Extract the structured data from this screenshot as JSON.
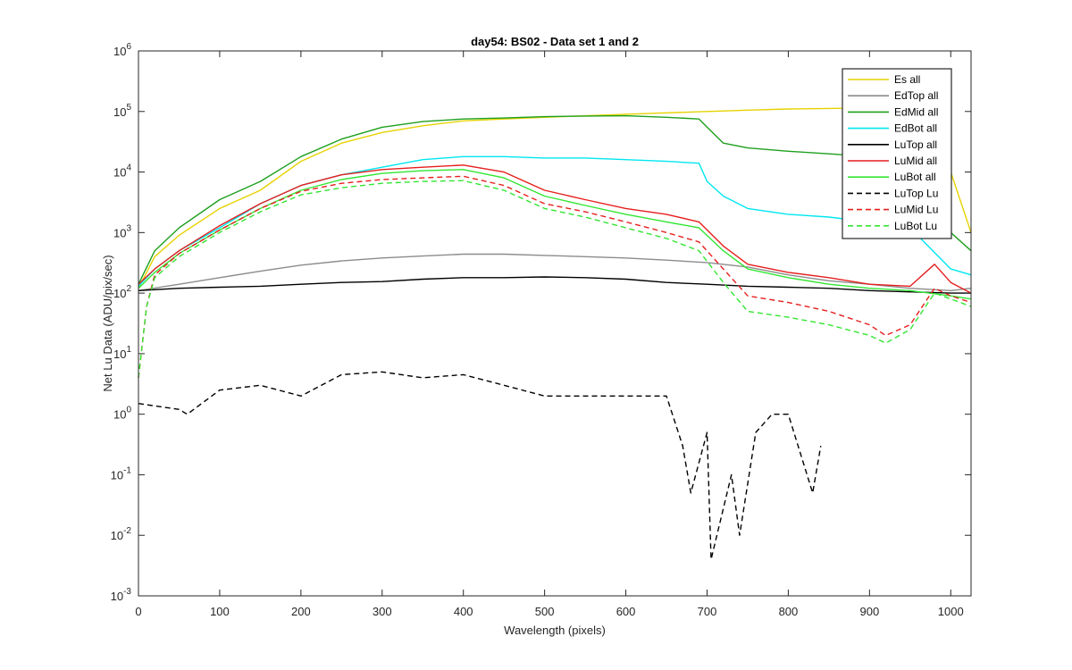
{
  "chart_data": {
    "type": "line",
    "title": "day54: BS02 - Data set 1 and 2",
    "xlabel": "Wavelength (pixels)",
    "ylabel": "Net Lu Data (ADU/pix/sec)",
    "xlim": [
      0,
      1025
    ],
    "ylim": [
      0.001,
      1000000
    ],
    "yscale": "log",
    "grid": false,
    "legend_position": "top-right",
    "x_ticks": [
      0,
      100,
      200,
      300,
      400,
      500,
      600,
      700,
      800,
      900,
      1000
    ],
    "x_tick_labels": [
      "0",
      "100",
      "200",
      "300",
      "400",
      "500",
      "600",
      "700",
      "800",
      "900",
      "1000"
    ],
    "y_ticks": [
      0.001,
      0.01,
      0.1,
      1,
      10,
      100,
      1000,
      10000,
      100000,
      1000000
    ],
    "y_tick_labels": [
      {
        "base": "10",
        "exp": "-3"
      },
      {
        "base": "10",
        "exp": "-2"
      },
      {
        "base": "10",
        "exp": "-1"
      },
      {
        "base": "10",
        "exp": "0"
      },
      {
        "base": "10",
        "exp": "1"
      },
      {
        "base": "10",
        "exp": "2"
      },
      {
        "base": "10",
        "exp": "3"
      },
      {
        "base": "10",
        "exp": "4"
      },
      {
        "base": "10",
        "exp": "5"
      },
      {
        "base": "10",
        "exp": "6"
      }
    ],
    "series": [
      {
        "name": "Es  all",
        "color": "#E6D200",
        "dash": "solid",
        "x": [
          0,
          20,
          50,
          100,
          150,
          200,
          250,
          300,
          350,
          400,
          450,
          500,
          550,
          600,
          650,
          700,
          750,
          800,
          850,
          900,
          950,
          980,
          1000,
          1025
        ],
        "y": [
          120,
          400,
          900,
          2500,
          5000,
          15000,
          30000,
          45000,
          58000,
          70000,
          75000,
          80000,
          85000,
          90000,
          95000,
          100000,
          105000,
          110000,
          112000,
          115000,
          110000,
          50000,
          10000,
          1000
        ]
      },
      {
        "name": "EdTop  all",
        "color": "#8C8C8C",
        "dash": "solid",
        "x": [
          0,
          50,
          100,
          150,
          200,
          250,
          300,
          350,
          400,
          450,
          500,
          550,
          600,
          650,
          700,
          750,
          800,
          850,
          900,
          950,
          1000,
          1025
        ],
        "y": [
          110,
          140,
          180,
          230,
          290,
          340,
          380,
          410,
          440,
          440,
          420,
          400,
          380,
          350,
          320,
          270,
          200,
          160,
          140,
          120,
          110,
          120
        ]
      },
      {
        "name": "EdMid  all",
        "color": "#1EA01E",
        "dash": "solid",
        "x": [
          0,
          20,
          50,
          100,
          150,
          200,
          250,
          300,
          350,
          400,
          450,
          500,
          550,
          600,
          650,
          690,
          700,
          720,
          750,
          800,
          850,
          900,
          950,
          990,
          1000,
          1025
        ],
        "y": [
          140,
          500,
          1200,
          3500,
          7000,
          18000,
          35000,
          55000,
          68000,
          75000,
          78000,
          82000,
          84000,
          85000,
          80000,
          75000,
          55000,
          30000,
          25000,
          22000,
          20000,
          18000,
          15000,
          12000,
          1000,
          500
        ]
      },
      {
        "name": "EdBot  all",
        "color": "#00E6F0",
        "dash": "solid",
        "x": [
          0,
          20,
          50,
          100,
          150,
          200,
          250,
          300,
          350,
          400,
          450,
          500,
          550,
          600,
          650,
          690,
          700,
          720,
          750,
          800,
          850,
          900,
          950,
          1000,
          1025
        ],
        "y": [
          130,
          250,
          500,
          1200,
          3000,
          6000,
          9000,
          12000,
          16000,
          18000,
          18000,
          17000,
          17000,
          16000,
          15000,
          14000,
          7000,
          4000,
          2500,
          2000,
          1800,
          1500,
          1200,
          250,
          200
        ]
      },
      {
        "name": "LuTop  all",
        "color": "#000000",
        "dash": "solid",
        "x": [
          0,
          50,
          100,
          150,
          200,
          250,
          300,
          350,
          400,
          450,
          500,
          550,
          600,
          650,
          700,
          750,
          800,
          850,
          900,
          950,
          1000,
          1025
        ],
        "y": [
          110,
          120,
          125,
          130,
          140,
          150,
          155,
          170,
          180,
          180,
          185,
          180,
          170,
          150,
          140,
          130,
          125,
          120,
          110,
          105,
          100,
          100
        ]
      },
      {
        "name": "LuMid  all",
        "color": "#E61E1E",
        "dash": "solid",
        "x": [
          0,
          20,
          50,
          100,
          150,
          200,
          250,
          300,
          350,
          400,
          450,
          500,
          550,
          600,
          650,
          690,
          720,
          750,
          800,
          850,
          900,
          950,
          980,
          1000,
          1025
        ],
        "y": [
          140,
          250,
          500,
          1300,
          3000,
          6000,
          9000,
          11000,
          12000,
          13000,
          10000,
          5000,
          3500,
          2500,
          2000,
          1500,
          600,
          300,
          220,
          180,
          140,
          130,
          300,
          150,
          100
        ]
      },
      {
        "name": "LuBot  all",
        "color": "#32E632",
        "dash": "solid",
        "x": [
          0,
          20,
          50,
          100,
          150,
          200,
          250,
          300,
          350,
          400,
          450,
          500,
          550,
          600,
          650,
          690,
          720,
          750,
          800,
          850,
          900,
          950,
          1000,
          1025
        ],
        "y": [
          120,
          220,
          450,
          1100,
          2500,
          5000,
          7500,
          9500,
          10500,
          11000,
          8000,
          4000,
          2800,
          2000,
          1500,
          1200,
          500,
          250,
          180,
          140,
          120,
          110,
          90,
          80
        ]
      },
      {
        "name": "LuTop  Lu",
        "color": "#000000",
        "dash": "dashed",
        "x": [
          0,
          50,
          60,
          100,
          150,
          200,
          250,
          300,
          350,
          400,
          450,
          500,
          550,
          600,
          650,
          670,
          680,
          700,
          705,
          730,
          740,
          760,
          780,
          800,
          830,
          840
        ],
        "y": [
          1.5,
          1.2,
          1.0,
          2.5,
          3.0,
          2.0,
          4.5,
          5.0,
          4.0,
          4.5,
          3.0,
          2.0,
          2.0,
          2.0,
          2.0,
          0.3,
          0.05,
          0.5,
          0.004,
          0.1,
          0.01,
          0.5,
          1.0,
          1.0,
          0.05,
          0.3
        ]
      },
      {
        "name": "LuMid  Lu",
        "color": "#E61E1E",
        "dash": "dashed",
        "x": [
          0,
          10,
          20,
          50,
          100,
          150,
          200,
          250,
          300,
          350,
          400,
          450,
          500,
          550,
          600,
          650,
          690,
          720,
          750,
          800,
          850,
          900,
          920,
          950,
          980,
          1000,
          1025
        ],
        "y": [
          4,
          60,
          200,
          450,
          1100,
          2500,
          4800,
          6500,
          7500,
          8000,
          8500,
          6000,
          3000,
          2200,
          1500,
          1000,
          700,
          250,
          90,
          70,
          50,
          30,
          20,
          30,
          120,
          90,
          70
        ]
      },
      {
        "name": "LuBot  Lu",
        "color": "#32E632",
        "dash": "dashed",
        "x": [
          0,
          10,
          20,
          50,
          100,
          150,
          200,
          250,
          300,
          350,
          400,
          450,
          500,
          550,
          600,
          650,
          690,
          720,
          750,
          800,
          850,
          900,
          920,
          950,
          980,
          1000,
          1025
        ],
        "y": [
          4,
          60,
          180,
          400,
          1000,
          2200,
          4200,
          5500,
          6500,
          7000,
          7200,
          5000,
          2500,
          1800,
          1200,
          800,
          500,
          150,
          50,
          40,
          30,
          20,
          15,
          25,
          100,
          80,
          60
        ]
      }
    ]
  }
}
